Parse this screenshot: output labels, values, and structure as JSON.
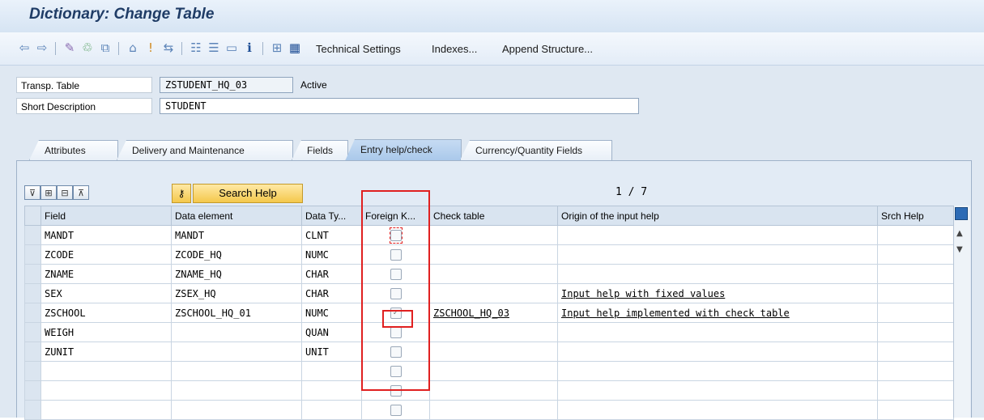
{
  "window": {
    "title": "Dictionary: Change Table"
  },
  "toolbar": {
    "icons": [
      "back-arrow-icon",
      "forward-arrow-icon",
      "display-change-icon",
      "activate-icon",
      "where-used-icon",
      "object-list-icon",
      "navigation-icon",
      "other-object-icon",
      "hierarchy-icon",
      "layout-icon",
      "screen-icon",
      "info-icon",
      "technical-icon",
      "table-icon"
    ],
    "technical_settings": "Technical Settings",
    "indexes": "Indexes...",
    "append_structure": "Append Structure..."
  },
  "header": {
    "transp_table_label": "Transp. Table",
    "transp_table_value": "ZSTUDENT_HQ_03",
    "status": "Active",
    "short_desc_label": "Short Description",
    "short_desc_value": "STUDENT"
  },
  "tabs": [
    "Attributes",
    "Delivery and Maintenance",
    "Fields",
    "Entry help/check",
    "Currency/Quantity Fields"
  ],
  "active_tab": "Entry help/check",
  "entry_help": {
    "search_help_button": "Search Help",
    "pager": "1 / 7",
    "columns": [
      "Field",
      "Data element",
      "Data Ty...",
      "Foreign K...",
      "Check table",
      "Origin of the input help",
      "Srch Help"
    ],
    "rows": [
      {
        "field": "MANDT",
        "data_element": "MANDT",
        "data_type": "CLNT",
        "foreign_key": false,
        "check_table": "",
        "origin": "",
        "srch_help": ""
      },
      {
        "field": "ZCODE",
        "data_element": "ZCODE_HQ",
        "data_type": "NUMC",
        "foreign_key": false,
        "check_table": "",
        "origin": "",
        "srch_help": ""
      },
      {
        "field": "ZNAME",
        "data_element": "ZNAME_HQ",
        "data_type": "CHAR",
        "foreign_key": false,
        "check_table": "",
        "origin": "",
        "srch_help": ""
      },
      {
        "field": "SEX",
        "data_element": "ZSEX_HQ",
        "data_type": "CHAR",
        "foreign_key": false,
        "check_table": "",
        "origin": "Input help with fixed values",
        "srch_help": ""
      },
      {
        "field": "ZSCHOOL",
        "data_element": "ZSCHOOL_HQ_01",
        "data_type": "NUMC",
        "foreign_key": true,
        "check_table": "ZSCHOOL_HQ_03",
        "origin": "Input help implemented with check table",
        "srch_help": ""
      },
      {
        "field": "WEIGH",
        "data_element": "",
        "data_type": "QUAN",
        "foreign_key": false,
        "check_table": "",
        "origin": "",
        "srch_help": ""
      },
      {
        "field": "ZUNIT",
        "data_element": "",
        "data_type": "UNIT",
        "foreign_key": false,
        "check_table": "",
        "origin": "",
        "srch_help": ""
      },
      {
        "field": "",
        "data_element": "",
        "data_type": "",
        "foreign_key": false,
        "check_table": "",
        "origin": "",
        "srch_help": ""
      },
      {
        "field": "",
        "data_element": "",
        "data_type": "",
        "foreign_key": false,
        "check_table": "",
        "origin": "",
        "srch_help": ""
      },
      {
        "field": "",
        "data_element": "",
        "data_type": "",
        "foreign_key": false,
        "check_table": "",
        "origin": "",
        "srch_help": ""
      }
    ]
  },
  "colors": {
    "highlight": "#e02020",
    "title": "#1f3c66",
    "button": "#f4c84c"
  }
}
